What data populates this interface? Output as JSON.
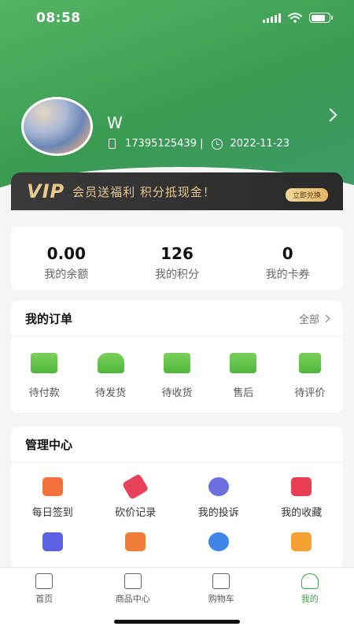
{
  "status": {
    "time": "08:58"
  },
  "profile": {
    "name": "W",
    "phone": "17395125439 |",
    "date": "2022-11-23"
  },
  "vip": {
    "logo": "VIP",
    "text": "会员送福利 积分抵现金！",
    "button": "立即兑换",
    "color": "#e8c88b"
  },
  "stats": [
    {
      "value": "0.00",
      "label": "我的余额"
    },
    {
      "value": "126",
      "label": "我的积分"
    },
    {
      "value": "0",
      "label": "我的卡券"
    }
  ],
  "orders": {
    "title": "我的订单",
    "more": "全部",
    "items": [
      {
        "label": "待付款",
        "icon": "wallet-icon"
      },
      {
        "label": "待发货",
        "icon": "scooter-icon"
      },
      {
        "label": "待收货",
        "icon": "bag-icon"
      },
      {
        "label": "售后",
        "icon": "return-icon"
      },
      {
        "label": "待评价",
        "icon": "review-icon"
      }
    ]
  },
  "manage": {
    "title": "管理中心",
    "items": [
      {
        "label": "每日签到",
        "icon": "calendar-check-icon",
        "color": "#f2703a"
      },
      {
        "label": "砍价记录",
        "icon": "price-tag-icon",
        "color": "#e8425a"
      },
      {
        "label": "我的投诉",
        "icon": "question-chat-icon",
        "color": "#6b6fe0"
      },
      {
        "label": "我的收藏",
        "icon": "heart-folder-icon",
        "color": "#ea3f52"
      },
      {
        "label": "",
        "icon": "ticket-icon",
        "color": "#5b61e0"
      },
      {
        "label": "",
        "icon": "mail-icon",
        "color": "#f07c3a"
      },
      {
        "label": "",
        "icon": "gear-icon",
        "color": "#3e86e8"
      },
      {
        "label": "",
        "icon": "store-icon",
        "color": "#f3a233"
      }
    ]
  },
  "tabbar": [
    {
      "label": "首页",
      "icon": "home-icon"
    },
    {
      "label": "商品中心",
      "icon": "shopping-bag-icon"
    },
    {
      "label": "购物车",
      "icon": "cart-icon"
    },
    {
      "label": "我的",
      "icon": "user-icon",
      "active": true
    }
  ],
  "accent": "#3aa14c"
}
